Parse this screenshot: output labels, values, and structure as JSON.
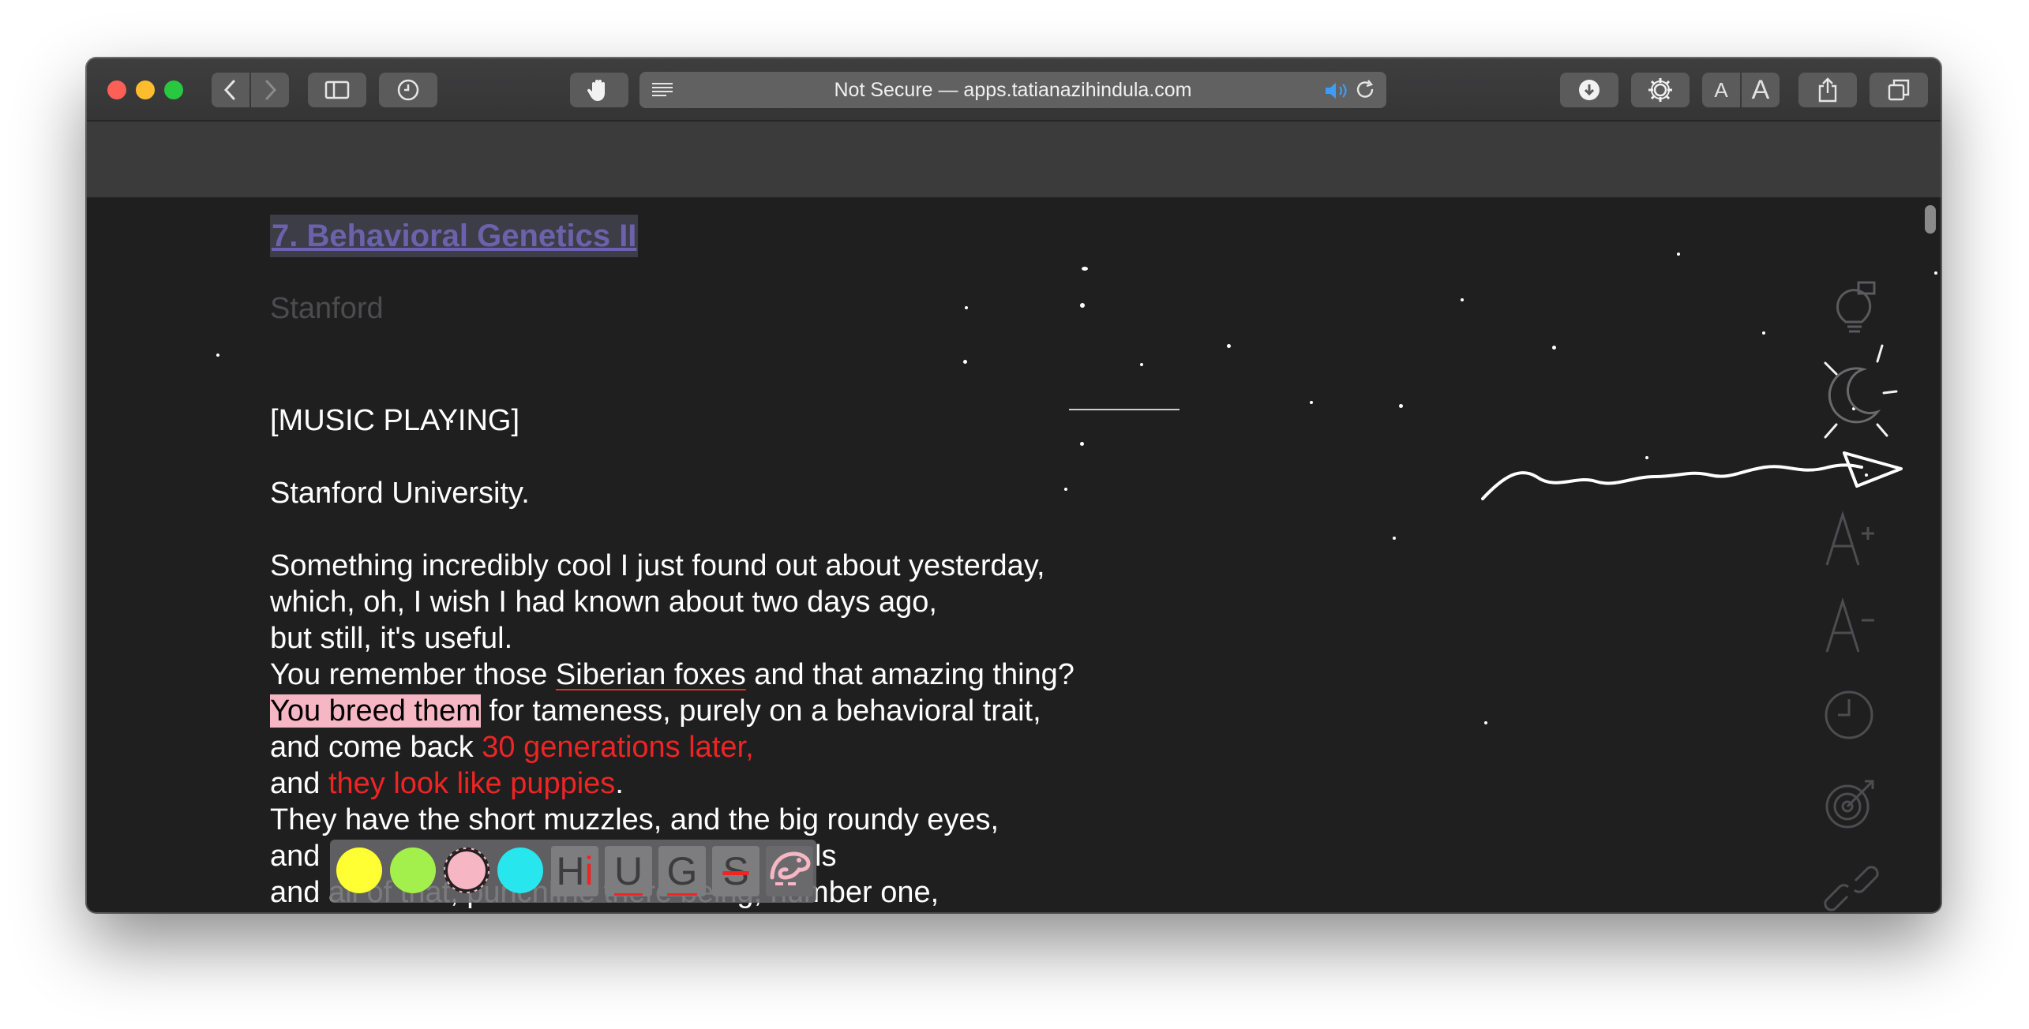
{
  "toolbar": {
    "url_text": "Not Secure — apps.tatianazihindula.com",
    "font_small_label": "A",
    "font_large_label": "A"
  },
  "article": {
    "title": "7. Behavioral Genetics II",
    "subtitle": "Stanford",
    "lines": {
      "music": "[MUSIC PLAYING]",
      "university": "Stanford University.",
      "p1": "Something incredibly cool I just found out about yesterday,",
      "p2": "which, oh, I wish I had known about two days ago,",
      "p3": "but still, it's useful.",
      "p4_a": "You remember those ",
      "p4_b": "Siberian foxes",
      "p4_c": " and that amazing thing?",
      "p5_a": "You breed them",
      "p5_b": " for tameness, purely on a behavioral trait,",
      "p6_a": "and come back ",
      "p6_b": "30 generations later,",
      "p7_a": "and ",
      "p7_b": "they look like puppies",
      "p7_c": ".",
      "p8": "They have the short muzzles, and the big roundy eyes,",
      "p9_a": "and",
      "p9_b": "ls",
      "p10": "and all of that, punchline there being, number one,"
    }
  },
  "highlighter": {
    "colors": [
      "#ffff33",
      "#a3f04c",
      "#f7b6c3",
      "#27e6ee"
    ],
    "format_labels": {
      "highlight_h": "H",
      "highlight_i": "i",
      "underline": "U",
      "squiggle": "G",
      "strike": "S"
    }
  },
  "colors": {
    "link_title": "#6a63ab",
    "highlight_pink": "#f7b6c3",
    "red_text": "#ef2424"
  },
  "side_icons": [
    "idea-bulb-icon",
    "moon-icon",
    "font-increase-icon",
    "font-decrease-icon",
    "clock-icon",
    "target-icon",
    "link-icon"
  ]
}
